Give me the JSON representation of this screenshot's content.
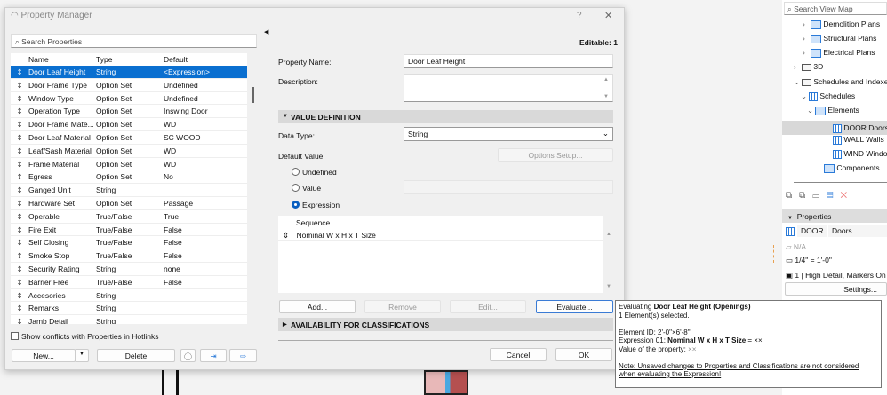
{
  "dialog": {
    "title": "Property Manager",
    "help": "?",
    "close": "✕"
  },
  "left": {
    "search_placeholder": "Search Properties",
    "columns": [
      "Name",
      "Type",
      "Default"
    ],
    "rows": [
      [
        "Door Leaf Height",
        "String",
        "<Expression>"
      ],
      [
        "Door Frame Type",
        "Option Set",
        "Undefined"
      ],
      [
        "Window Type",
        "Option Set",
        "Undefined"
      ],
      [
        "Operation Type",
        "Option Set",
        "Inswing Door"
      ],
      [
        "Door Frame Mate...",
        "Option Set",
        "WD"
      ],
      [
        "Door Leaf Material",
        "Option Set",
        "SC WOOD"
      ],
      [
        "Leaf/Sash Material",
        "Option Set",
        "WD"
      ],
      [
        "Frame Material",
        "Option Set",
        "WD"
      ],
      [
        "Egress",
        "Option Set",
        "No"
      ],
      [
        "Ganged Unit",
        "String",
        ""
      ],
      [
        "Hardware Set",
        "Option Set",
        "Passage"
      ],
      [
        "Operable",
        "True/False",
        "True"
      ],
      [
        "Fire Exit",
        "True/False",
        "False"
      ],
      [
        "Self Closing",
        "True/False",
        "False"
      ],
      [
        "Smoke Stop",
        "True/False",
        "False"
      ],
      [
        "Security Rating",
        "String",
        "none"
      ],
      [
        "Barrier Free",
        "True/False",
        "False"
      ],
      [
        "Accesories",
        "String",
        ""
      ],
      [
        "Remarks",
        "String",
        ""
      ],
      [
        "Jamb Detail",
        "String",
        ""
      ]
    ],
    "show_conflicts": "Show conflicts with Properties in Hotlinks",
    "new_label": "New...",
    "delete_label": "Delete"
  },
  "right": {
    "editable": "Editable: 1",
    "property_name_label": "Property Name:",
    "property_name": "Door Leaf Height",
    "description_label": "Description:",
    "value_definition": "VALUE DEFINITION",
    "data_type_label": "Data Type:",
    "data_type": "String",
    "default_value_label": "Default Value:",
    "options_setup": "Options Setup...",
    "radios": [
      "Undefined",
      "Value",
      "Expression"
    ],
    "sequence_header": "Sequence",
    "sequence_rows": [
      "Nominal W x H x T Size"
    ],
    "add": "Add...",
    "remove": "Remove",
    "edit": "Edit...",
    "evaluate": "Evaluate...",
    "availability": "AVAILABILITY FOR CLASSIFICATIONS",
    "cancel": "Cancel",
    "ok": "OK"
  },
  "tooltip": {
    "evaluating": "Evaluating ",
    "prop": "Door Leaf Height (Openings)",
    "selected": "1 Element(s) selected.",
    "element_id": "Element ID: 2'-0\"×6'-8\"",
    "expr_prefix": "Expression 01: ",
    "expr_name": "Nominal W x H x T Size",
    "expr_eq": " = ××",
    "value_prefix": "Value of the property: ",
    "value": "××",
    "note1": "Note: Unsaved changes to Properties and Classifications are not considered",
    "note2": "when evaluating the Expression!"
  },
  "viewmap": {
    "search_placeholder": "Search View Map",
    "items": [
      "Demolition Plans",
      "Structural Plans",
      "Electrical Plans",
      "3D",
      "Schedules and Indexes",
      "Schedules",
      "Elements",
      "DOOR Doors",
      "WALL Walls",
      "WIND Windows",
      "Components"
    ],
    "properties": "Properties",
    "id": "DOOR",
    "name": "Doors",
    "na": "N/A",
    "scale": "1/4\"   =   1'-0\"",
    "detail": "1 | High Detail, Markers On",
    "settings": "Settings..."
  }
}
